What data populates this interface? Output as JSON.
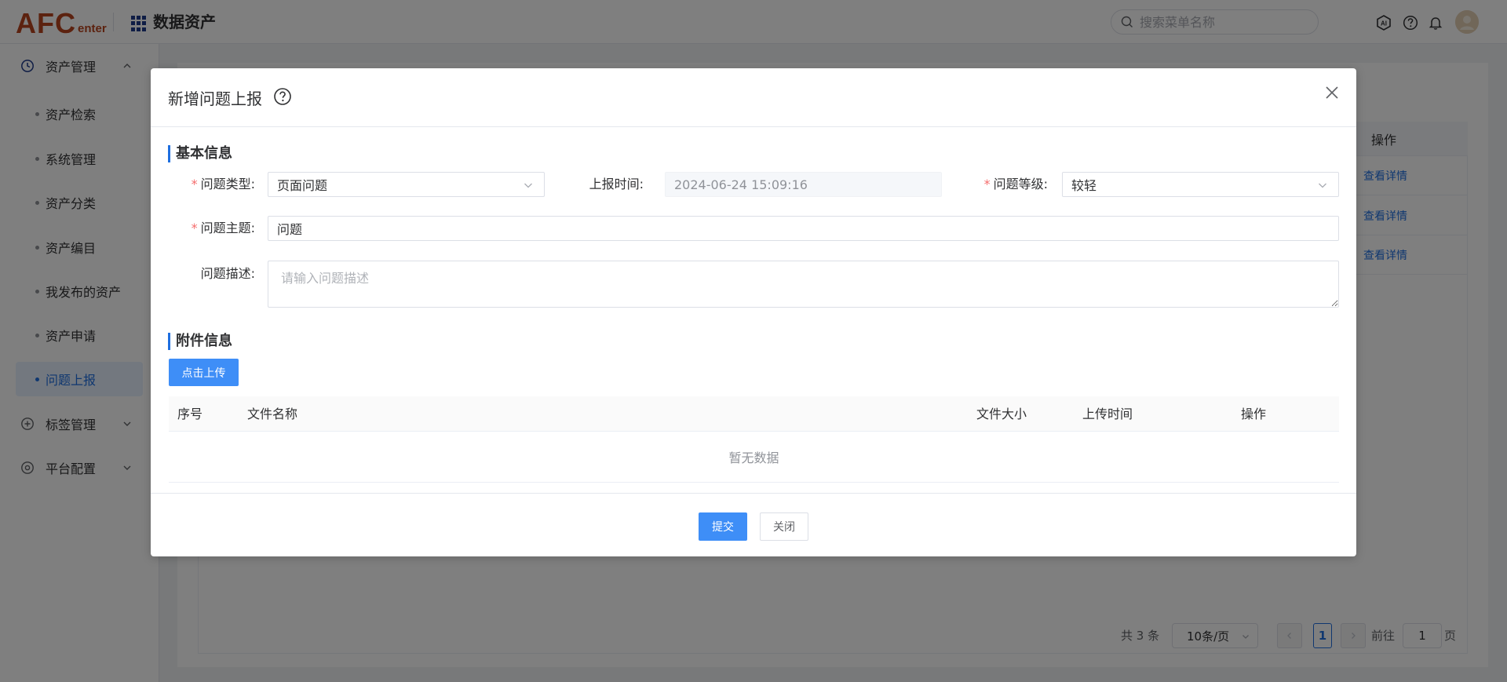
{
  "header": {
    "logo_main": "AFC",
    "logo_sub": "enter",
    "app_title": "数据资产",
    "search_placeholder": "搜索菜单名称"
  },
  "sidebar": {
    "groups": [
      {
        "label": "资产管理",
        "icon": "clock-icon",
        "expanded": true
      },
      {
        "label": "标签管理",
        "icon": "plus-circle-icon",
        "expanded": false
      },
      {
        "label": "平台配置",
        "icon": "settings-icon",
        "expanded": false
      }
    ],
    "items": [
      {
        "label": "资产检索"
      },
      {
        "label": "系统管理"
      },
      {
        "label": "资产分类"
      },
      {
        "label": "资产编目"
      },
      {
        "label": "我发布的资产"
      },
      {
        "label": "资产申请"
      },
      {
        "label": "问题上报",
        "active": true
      }
    ]
  },
  "background": {
    "table_op_header": "操作",
    "row_links": [
      "查看详情",
      "查看详情",
      "查看详情"
    ],
    "pagination": {
      "total": "共 3 条",
      "page_size": "10条/页",
      "current_page": "1",
      "goto_prefix": "前往",
      "goto_value": "1",
      "goto_suffix": "页"
    }
  },
  "dialog": {
    "title": "新增问题上报",
    "section_basic": "基本信息",
    "fields": {
      "issue_type": {
        "label": "问题类型:",
        "value": "页面问题",
        "required": true
      },
      "report_time": {
        "label": "上报时间:",
        "value": "2024-06-24 15:09:16",
        "required": false
      },
      "issue_level": {
        "label": "问题等级:",
        "value": "较轻",
        "required": true
      },
      "issue_subject": {
        "label": "问题主题:",
        "value": "问题",
        "required": true
      },
      "issue_desc": {
        "label": "问题描述:",
        "placeholder": "请输入问题描述",
        "required": false
      }
    },
    "section_attach": "附件信息",
    "upload_label": "点击上传",
    "attach_table": {
      "columns": [
        "序号",
        "文件名称",
        "文件大小",
        "上传时间",
        "操作"
      ],
      "empty_text": "暂无数据"
    },
    "submit_label": "提交",
    "close_label": "关闭"
  },
  "colors": {
    "primary": "#3e8ef7",
    "link": "#1f6fe0",
    "required": "#f56c6c",
    "logo": "#b8441f"
  }
}
